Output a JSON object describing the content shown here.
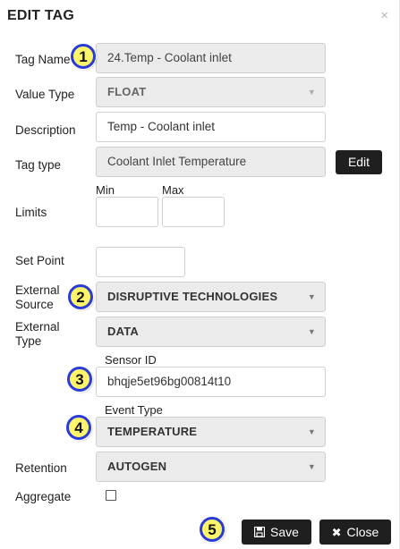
{
  "dialog": {
    "title": "EDIT TAG",
    "close_icon": "×"
  },
  "fields": {
    "tag_name": {
      "label": "Tag Name",
      "value": "24.Temp - Coolant inlet"
    },
    "value_type": {
      "label": "Value Type",
      "value": "FLOAT"
    },
    "description": {
      "label": "Description",
      "value": "Temp - Coolant inlet"
    },
    "tag_type": {
      "label": "Tag type",
      "value": "Coolant Inlet Temperature",
      "edit_button": "Edit"
    },
    "limits": {
      "label": "Limits",
      "min_label": "Min",
      "max_label": "Max",
      "min_value": "",
      "max_value": ""
    },
    "set_point": {
      "label": "Set Point",
      "value": ""
    },
    "external_source": {
      "label_line1": "External",
      "label_line2": "Source",
      "value": "DISRUPTIVE TECHNOLOGIES"
    },
    "external_type": {
      "label_line1": "External",
      "label_line2": "Type",
      "value": "DATA"
    },
    "sensor_id": {
      "label": "Sensor ID",
      "value": "bhqje5et96bg00814t10"
    },
    "event_type": {
      "label": "Event Type",
      "value": "TEMPERATURE"
    },
    "retention": {
      "label": "Retention",
      "value": "AUTOGEN"
    },
    "aggregate": {
      "label": "Aggregate",
      "checked": false
    }
  },
  "footer": {
    "save_label": "Save",
    "close_label": "Close",
    "save_icon": "floppy-disk-icon",
    "close_icon": "x-icon"
  },
  "annotations": [
    "1",
    "2",
    "3",
    "4",
    "5"
  ],
  "colors": {
    "badge_fill": "#fff56a",
    "badge_border": "#2a3bd8",
    "button_dark": "#1f1f1f",
    "readonly_bg": "#ebebeb"
  }
}
